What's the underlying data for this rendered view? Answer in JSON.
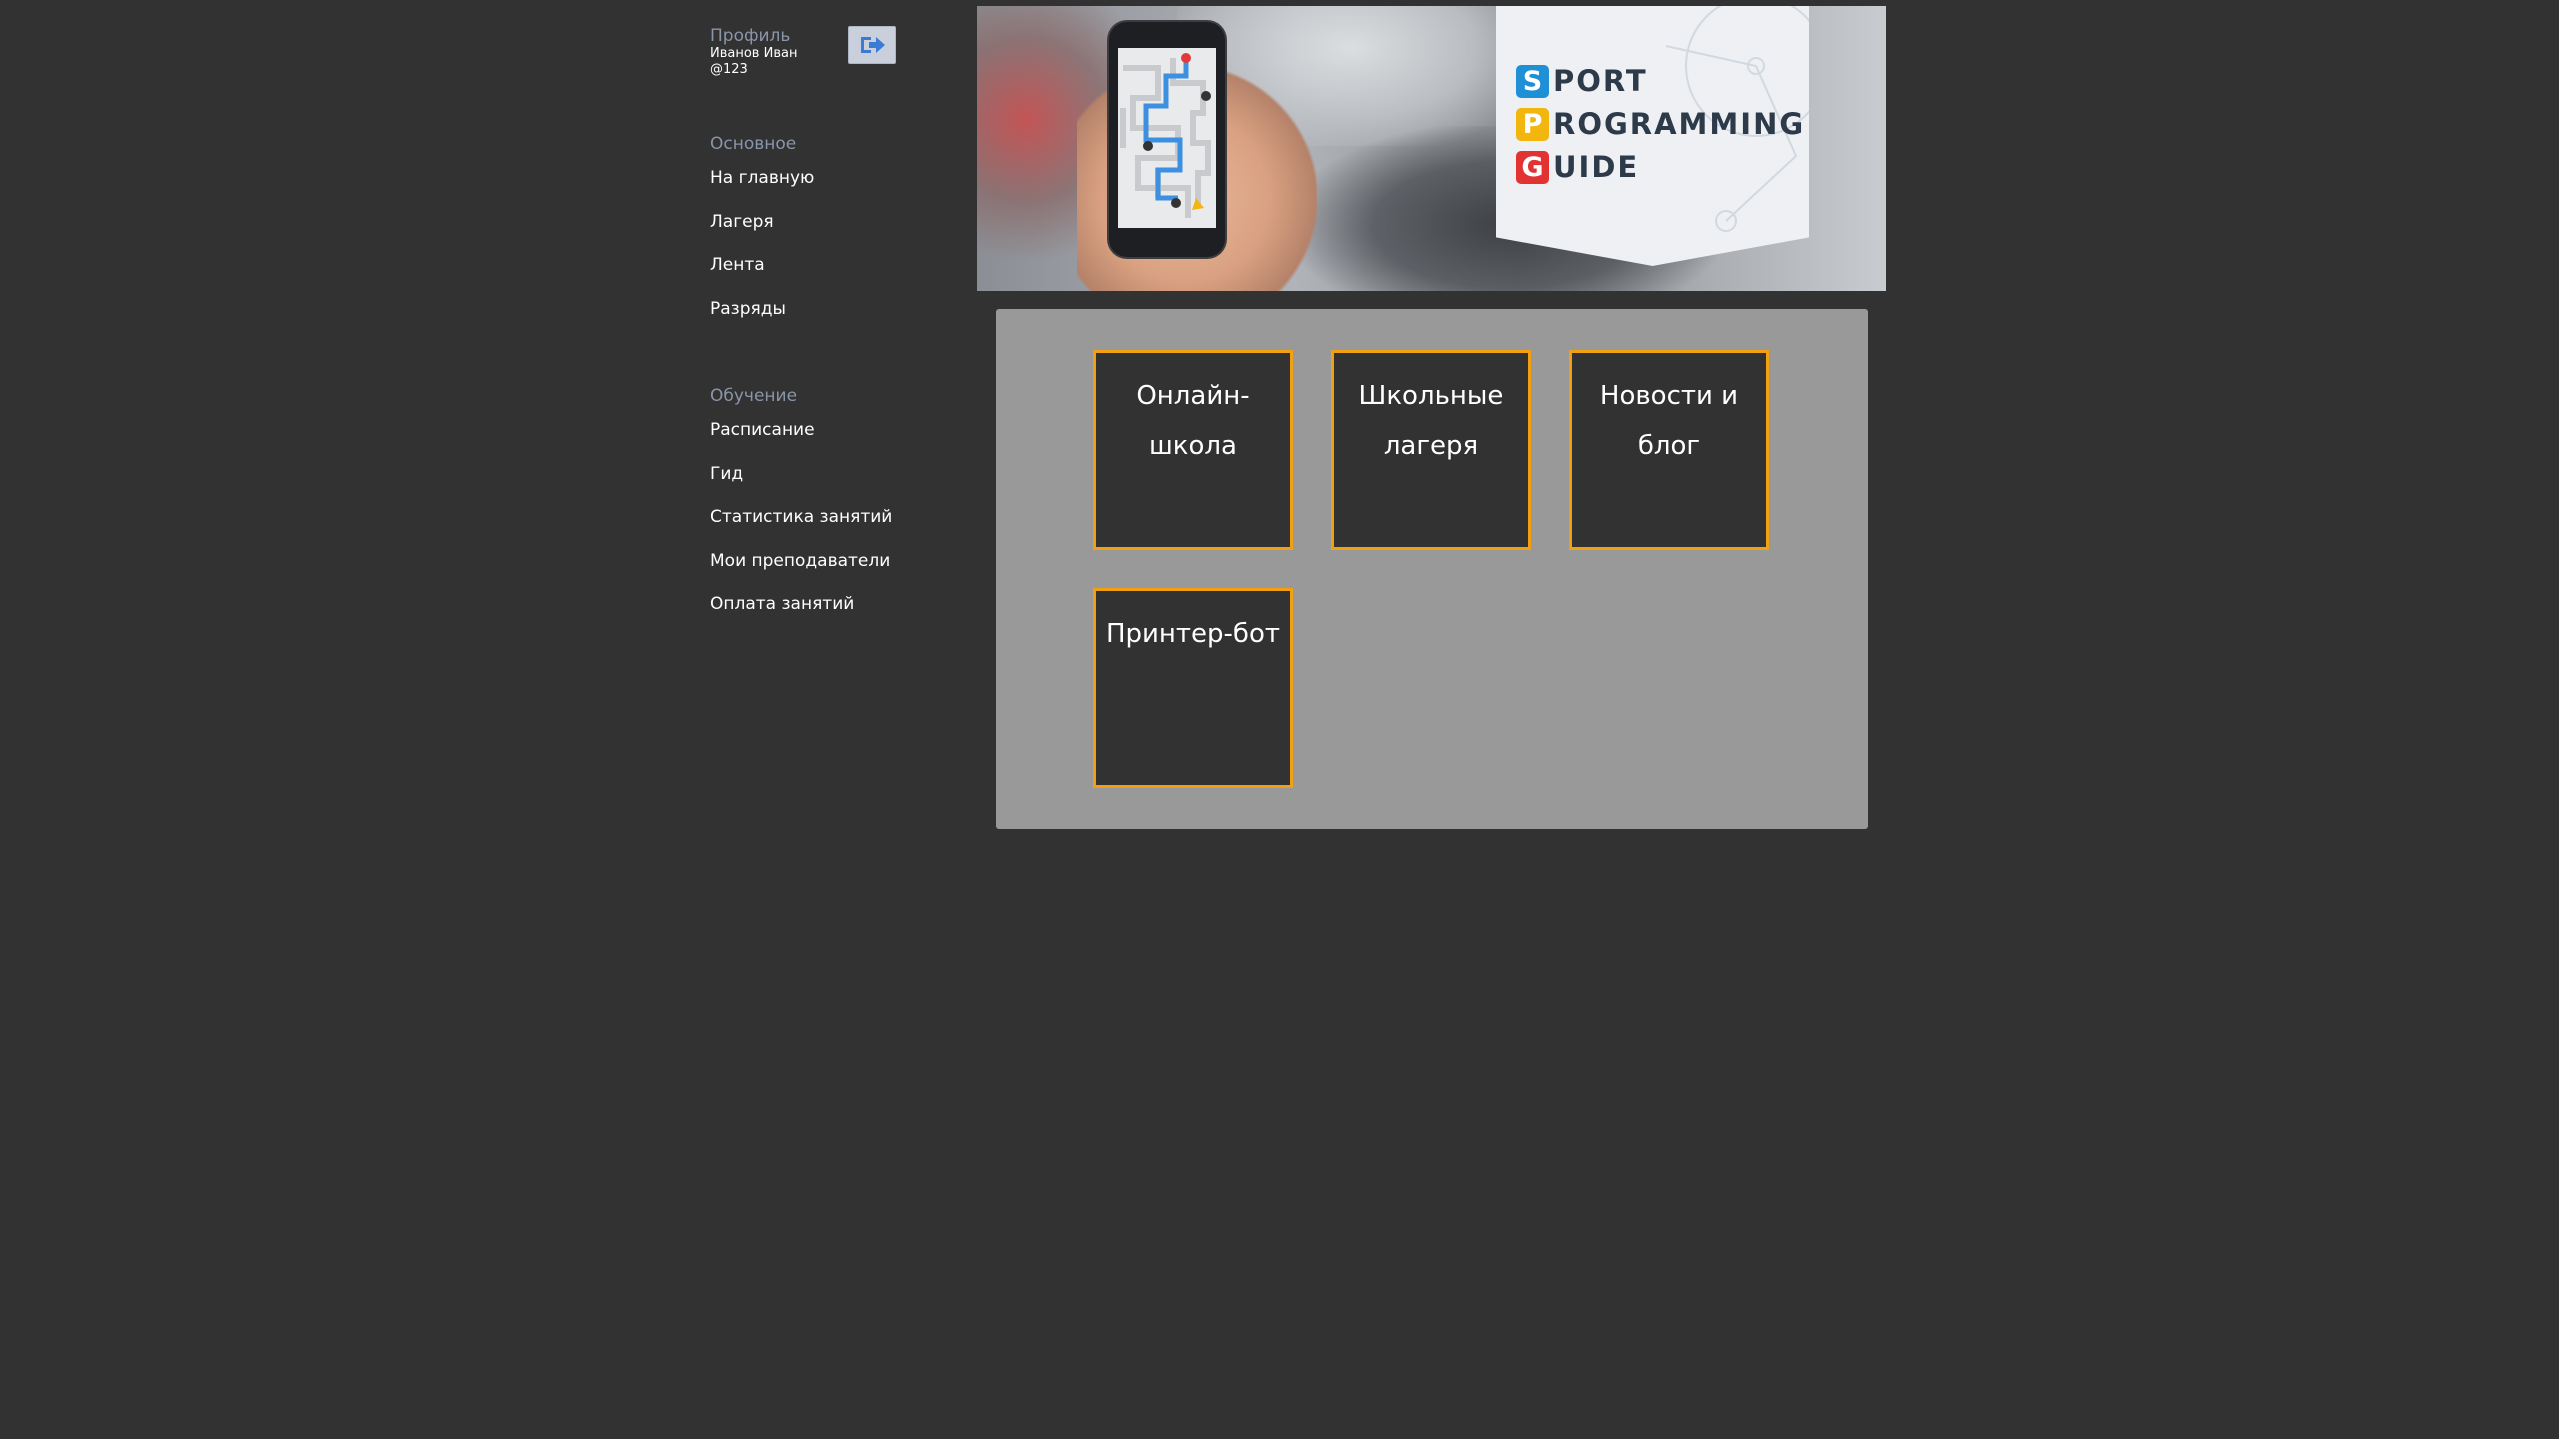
{
  "profile": {
    "title": "Профиль",
    "name": "Иванов Иван",
    "handle": "@123",
    "logout_icon": "logout-arrow-icon"
  },
  "sections": {
    "main": {
      "title": "Основное",
      "items": [
        "На главную",
        "Лагеря",
        "Лента",
        "Разряды"
      ]
    },
    "learning": {
      "title": "Обучение",
      "items": [
        "Расписание",
        "Гид",
        "Статистика занятий",
        "Мои преподаватели",
        "Оплата занятий"
      ]
    }
  },
  "banner": {
    "logo": {
      "line1_letter": "S",
      "line1_rest": "PORT",
      "line2_letter": "P",
      "line2_rest": "ROGRAMMING",
      "line3_letter": "G",
      "line3_rest": "UIDE"
    },
    "colors": {
      "s": "#1f8fd6",
      "p": "#f2b60f",
      "g": "#e23232"
    }
  },
  "tiles": [
    {
      "label": "Онлайн-школа"
    },
    {
      "label": "Школьные лагеря"
    },
    {
      "label": "Новости и блог"
    },
    {
      "label": "Принтер-бот"
    }
  ],
  "colors": {
    "background": "#323232",
    "panel": "#999999",
    "tile_border": "#f0a012",
    "section_title": "#8a95a8"
  }
}
